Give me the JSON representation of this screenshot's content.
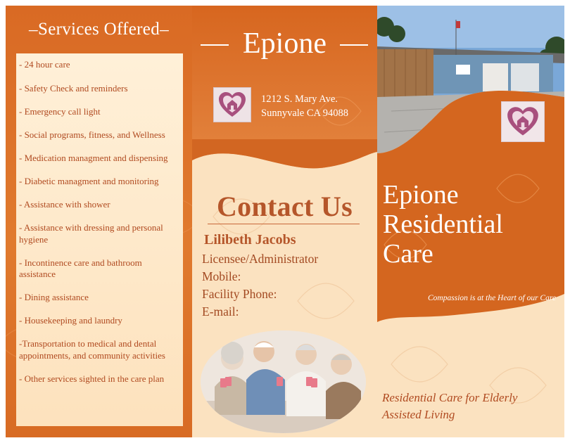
{
  "services": {
    "title": "Services Offered",
    "items": [
      "- 24 hour care",
      "- Safety Check and reminders",
      "- Emergency call light",
      "- Social programs, fitness, and Wellness",
      "- Medication managment and dispensing",
      "- Diabetic managment and monitoring",
      "- Assistance with shower",
      "- Assistance with dressing and personal hygiene",
      "- Incontinence care and bathroom assistance",
      "- Dining assistance",
      "- Housekeeping and laundry",
      "-Transportation to medical and dental appointments, and community activities",
      "- Other services sighted in the care plan"
    ]
  },
  "brand": {
    "name": "Epione",
    "address_line1": "1212 S. Mary Ave.",
    "address_line2": "Sunnyvale CA 94088"
  },
  "contact": {
    "heading": "Contact Us",
    "person": "Lilibeth Jacobs",
    "role": "Licensee/Administrator",
    "mobile_label": "Mobile:",
    "phone_label": "Facility Phone:",
    "email_label": "E-mail:"
  },
  "cover": {
    "title_line1": "Epione",
    "title_line2": "Residential",
    "title_line3": "Care",
    "tagline": "Compassion is at the Heart of our Care",
    "footer_line1": "Residential Care for Elderly",
    "footer_line2": "Assisted Living"
  },
  "colors": {
    "orange": "#d96a24",
    "cream": "#fbe2c0",
    "rust_text": "#b5562a",
    "logo_heart": "#a8507e"
  },
  "icons": [
    "heart-house-logo-icon"
  ]
}
